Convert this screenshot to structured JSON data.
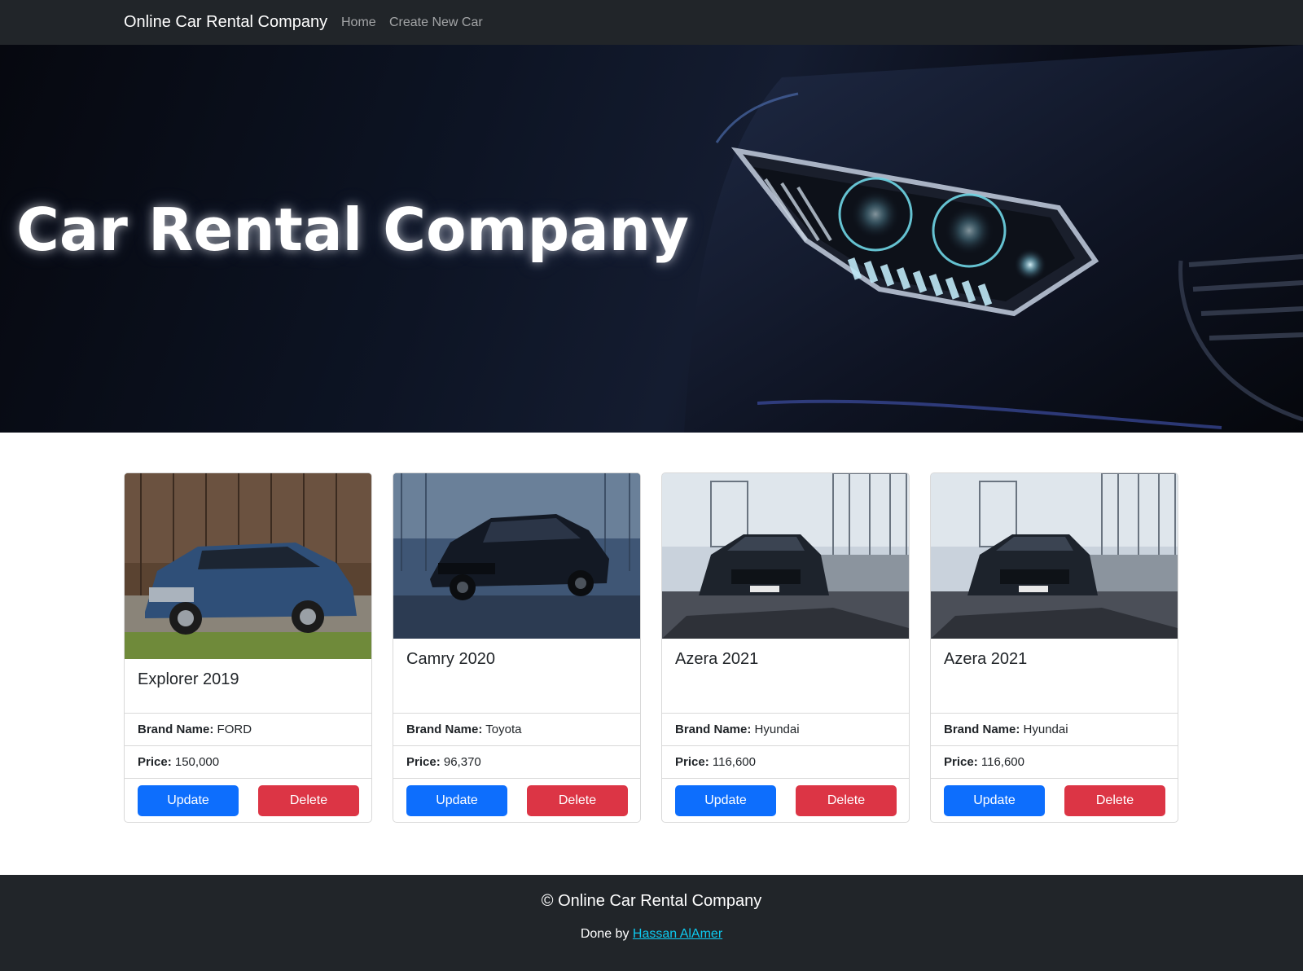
{
  "navbar": {
    "brand": "Online Car Rental Company",
    "links": [
      {
        "label": "Home"
      },
      {
        "label": "Create New Car"
      }
    ]
  },
  "hero": {
    "title": "Car Rental Company"
  },
  "cards": [
    {
      "title": "Explorer 2019",
      "brand_label": "Brand Name:",
      "brand": "FORD",
      "price_label": "Price:",
      "price": "150,000",
      "update_label": "Update",
      "delete_label": "Delete",
      "image_icon": "blue-suv-photo"
    },
    {
      "title": "Camry 2020",
      "brand_label": "Brand Name:",
      "brand": "Toyota",
      "price_label": "Price:",
      "price": "96,370",
      "update_label": "Update",
      "delete_label": "Delete",
      "image_icon": "dark-sedan-photo"
    },
    {
      "title": "Azera 2021",
      "brand_label": "Brand Name:",
      "brand": "Hyundai",
      "price_label": "Price:",
      "price": "116,600",
      "update_label": "Update",
      "delete_label": "Delete",
      "image_icon": "dark-sedan-photo"
    },
    {
      "title": "Azera 2021",
      "brand_label": "Brand Name:",
      "brand": "Hyundai",
      "price_label": "Price:",
      "price": "116,600",
      "update_label": "Update",
      "delete_label": "Delete",
      "image_icon": "dark-sedan-photo"
    }
  ],
  "footer": {
    "copyright": "© Online Car Rental Company",
    "credit_prefix": "Done by",
    "credit_name": "Hassan AlAmer"
  },
  "colors": {
    "navbar_bg": "#212529",
    "primary": "#0d6efd",
    "danger": "#dc3545",
    "link": "#0dcaf0"
  }
}
